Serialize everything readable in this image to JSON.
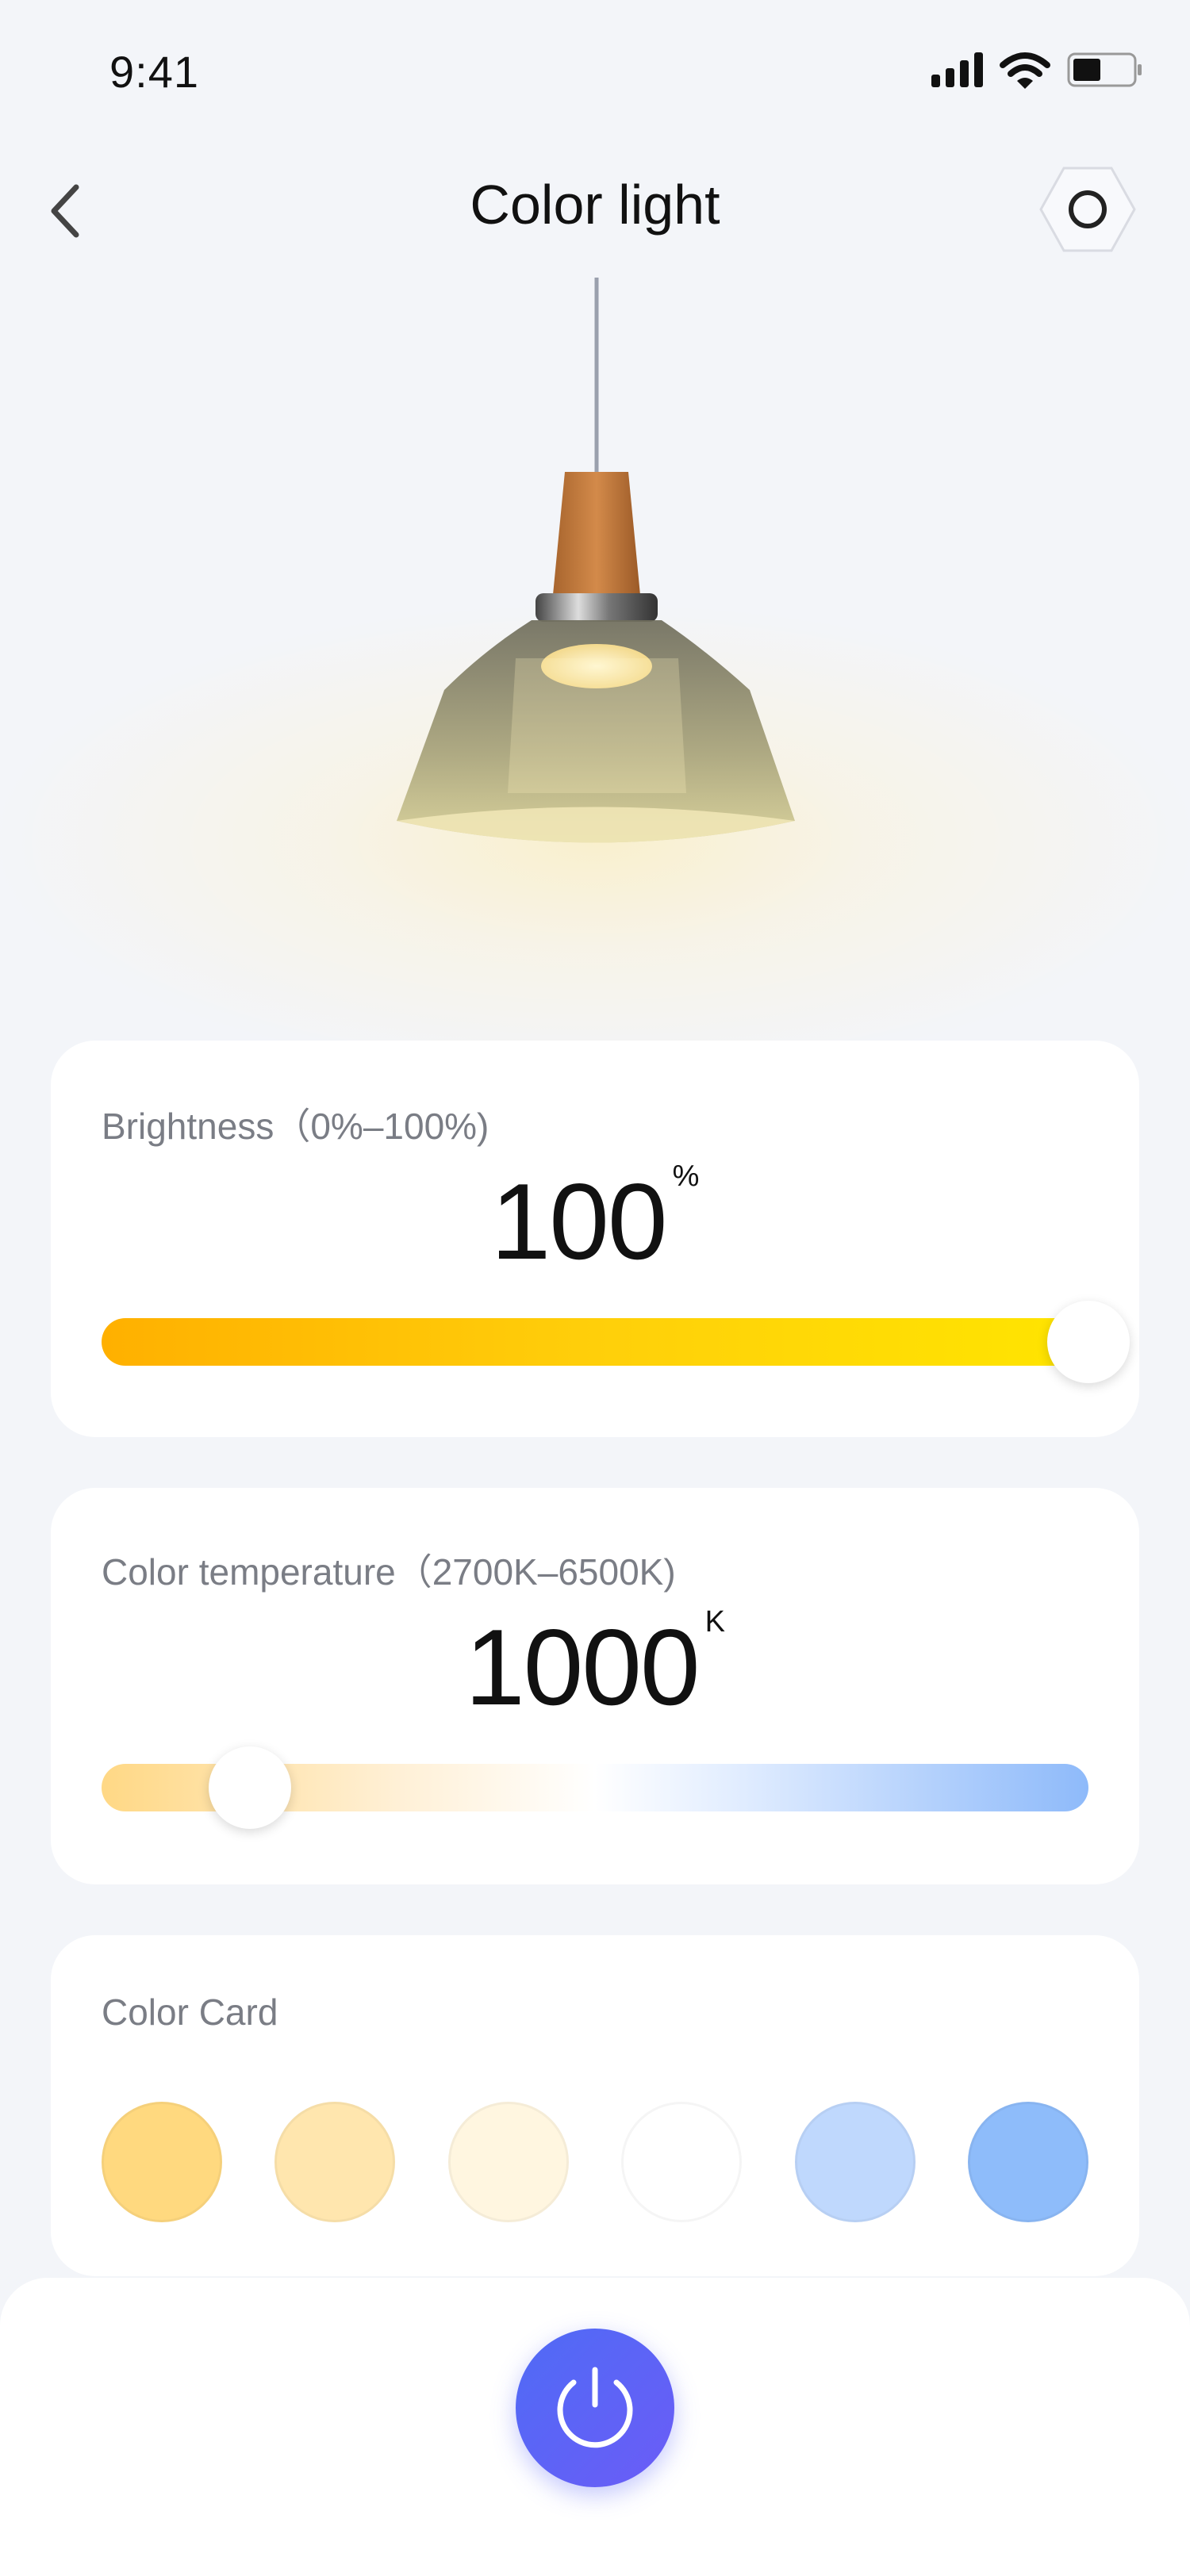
{
  "status_bar": {
    "time": "9:41",
    "icons": [
      "signal-icon",
      "wifi-icon",
      "battery-icon"
    ]
  },
  "header": {
    "title": "Color light",
    "back_icon": "chevron-left-icon",
    "settings_icon": "hexagon-settings-icon"
  },
  "brightness": {
    "label": "Brightness（0%–100%)",
    "value": "100",
    "unit": "%",
    "level": 1.0,
    "gradient_colors": [
      "#ffb000",
      "#ffe500"
    ]
  },
  "color_temperature": {
    "label": "Color temperature（2700K–6500K)",
    "value": "1000",
    "unit": "K",
    "level": 0.15,
    "gradient_colors": [
      "#ffd885",
      "#ffffff",
      "#8ebafa"
    ]
  },
  "color_card": {
    "label": "Color Card",
    "swatches": [
      "#ffd97f",
      "#ffe6ae",
      "#fff6e0",
      "#ffffff",
      "#bfd8fd",
      "#8ebcfa"
    ]
  },
  "power": {
    "icon": "power-icon",
    "colors": [
      "#4f6bf5",
      "#6b5cf7"
    ]
  }
}
